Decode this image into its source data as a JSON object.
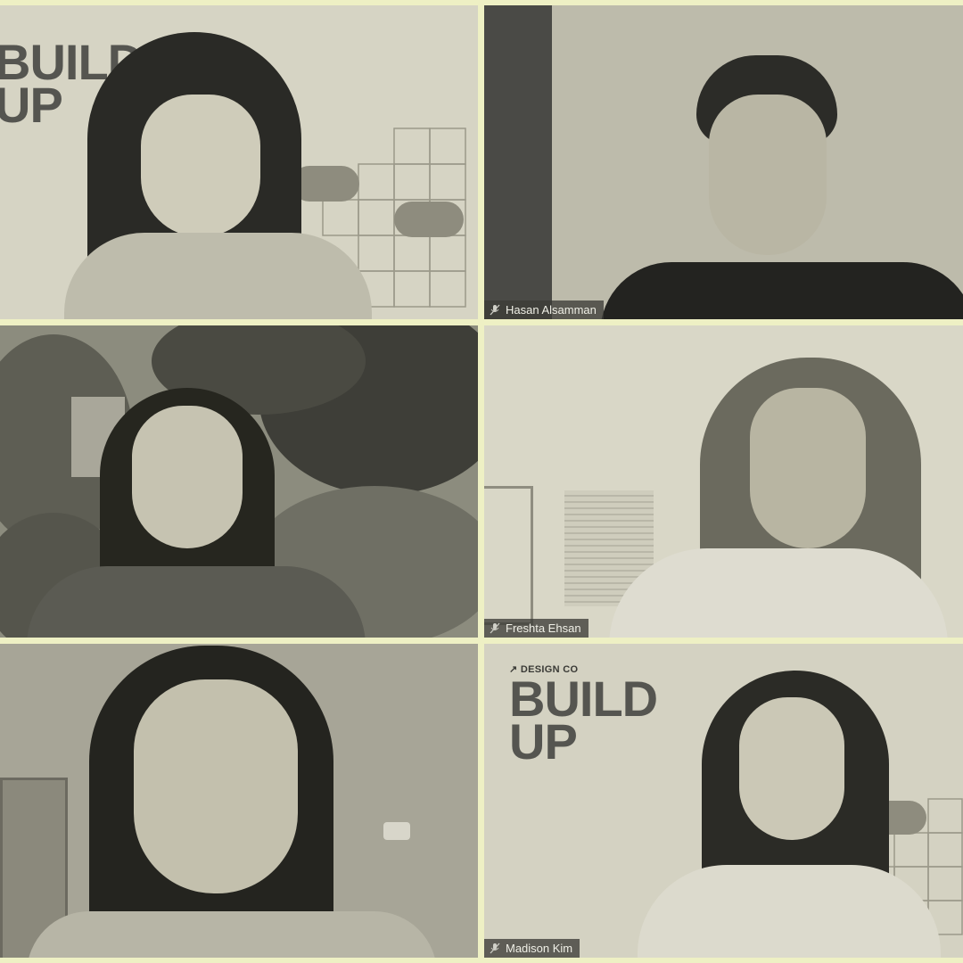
{
  "participants": [
    {
      "name": ""
    },
    {
      "name": "Hasan Alsamman"
    },
    {
      "name": ""
    },
    {
      "name": "Freshta Ehsan"
    },
    {
      "name": ""
    },
    {
      "name": "Madison Kim"
    }
  ],
  "branding": {
    "small": "DESIGN CO",
    "big_line1": "BUILD",
    "big_line2": "UP"
  },
  "colors": {
    "page_background": "#eef0c4",
    "tile_tint": "#d6d4c4",
    "label_background": "#3c3c37"
  }
}
